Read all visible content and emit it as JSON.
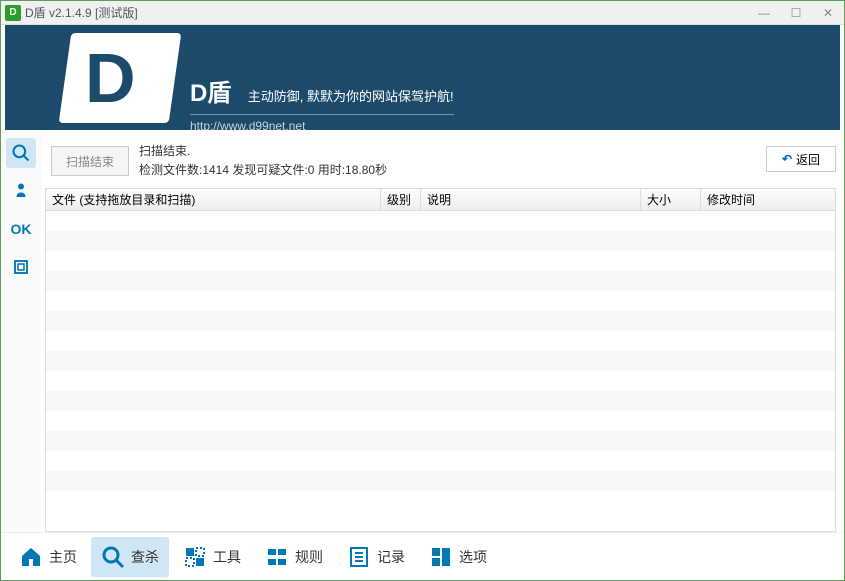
{
  "window": {
    "title": "D盾 v2.1.4.9 [测试版]",
    "minimize": "—",
    "maximize": "☐",
    "close": "✕"
  },
  "banner": {
    "app_name": "D盾",
    "tagline": "主动防御, 默默为你的网站保驾护航!",
    "url": "http://www.d99net.net"
  },
  "sidebar": {
    "ok_label": "OK"
  },
  "controls": {
    "scan_button": "扫描结束",
    "status_line1": "扫描结束.",
    "status_line2": "检测文件数:1414 发现可疑文件:0 用时:18.80秒",
    "return_button": "返回"
  },
  "table": {
    "headers": {
      "file": "文件 (支持拖放目录和扫描)",
      "level": "级别",
      "desc": "说明",
      "size": "大小",
      "time": "修改时间"
    },
    "rows": []
  },
  "tabs": {
    "home": "主页",
    "scan": "查杀",
    "tools": "工具",
    "rules": "规则",
    "records": "记录",
    "options": "选项"
  },
  "colors": {
    "accent": "#0078b4",
    "banner": "#1b4a6b"
  }
}
